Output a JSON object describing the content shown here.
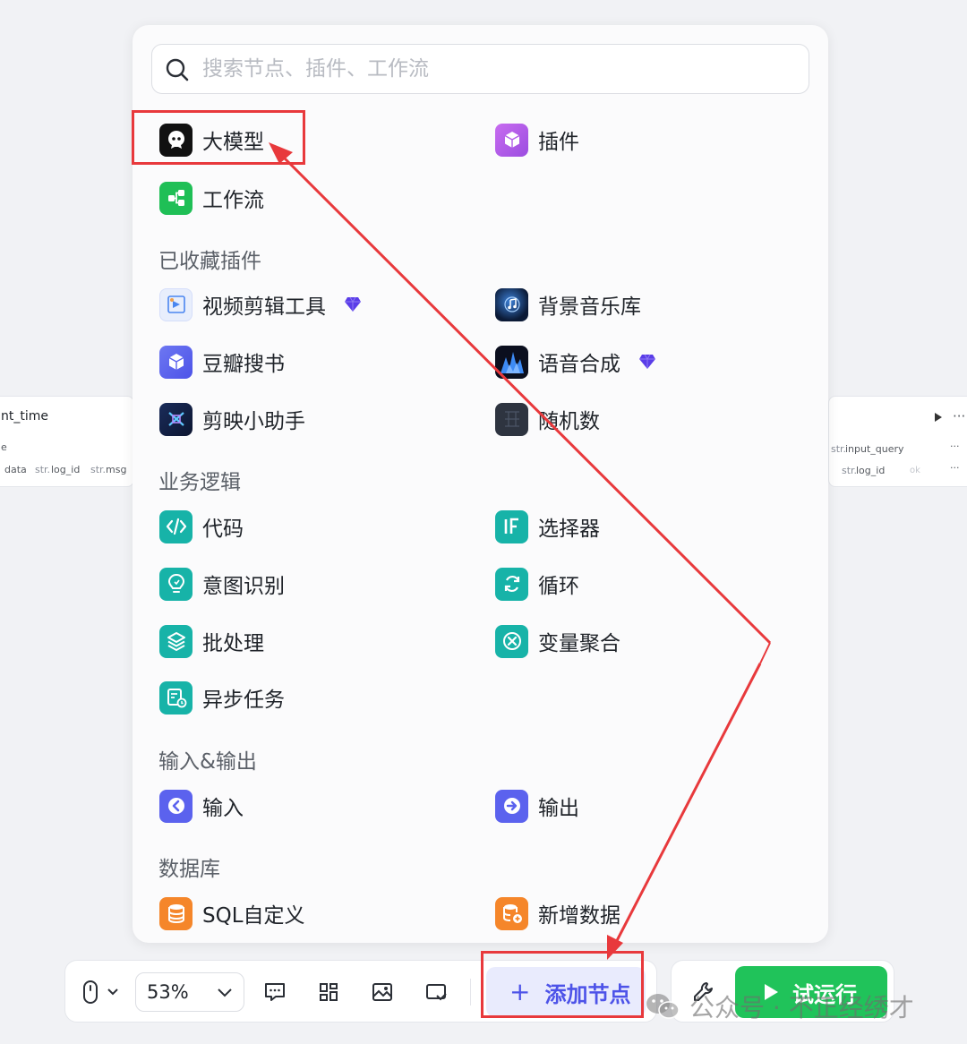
{
  "search": {
    "placeholder": "搜索节点、插件、工作流"
  },
  "items": {
    "llm": "大模型",
    "plugin": "插件",
    "workflow": "工作流",
    "video_edit": "视频剪辑工具",
    "bgm": "背景音乐库",
    "douban": "豆瓣搜书",
    "tts": "语音合成",
    "jianying": "剪映小助手",
    "random": "随机数",
    "code": "代码",
    "selector": "选择器",
    "intent": "意图识别",
    "loop": "循环",
    "batch": "批处理",
    "var_agg": "变量聚合",
    "async": "异步任务",
    "input": "输入",
    "output": "输出",
    "sql": "SQL自定义",
    "add_data": "新增数据"
  },
  "sections": {
    "favorites": "已收藏插件",
    "logic": "业务逻辑",
    "io": "输入&输出",
    "database": "数据库"
  },
  "background": {
    "left_title": "nt_time",
    "left_sub": "e",
    "left_tags": [
      "data",
      "log_id",
      "msg"
    ],
    "tag_prefix": "str.",
    "right_tags": [
      "input_query",
      "log_id"
    ],
    "right_ok": "ok",
    "more": "···"
  },
  "toolbar": {
    "zoom": "53%",
    "add_node": "添加节点",
    "run": "试运行"
  },
  "watermark": "公众号 · 不正经绣才",
  "colors": {
    "accent": "#4d53e8",
    "run_green": "#20c35a",
    "teal_icons": "#17b3a8",
    "highlight_red": "#e8393c"
  }
}
